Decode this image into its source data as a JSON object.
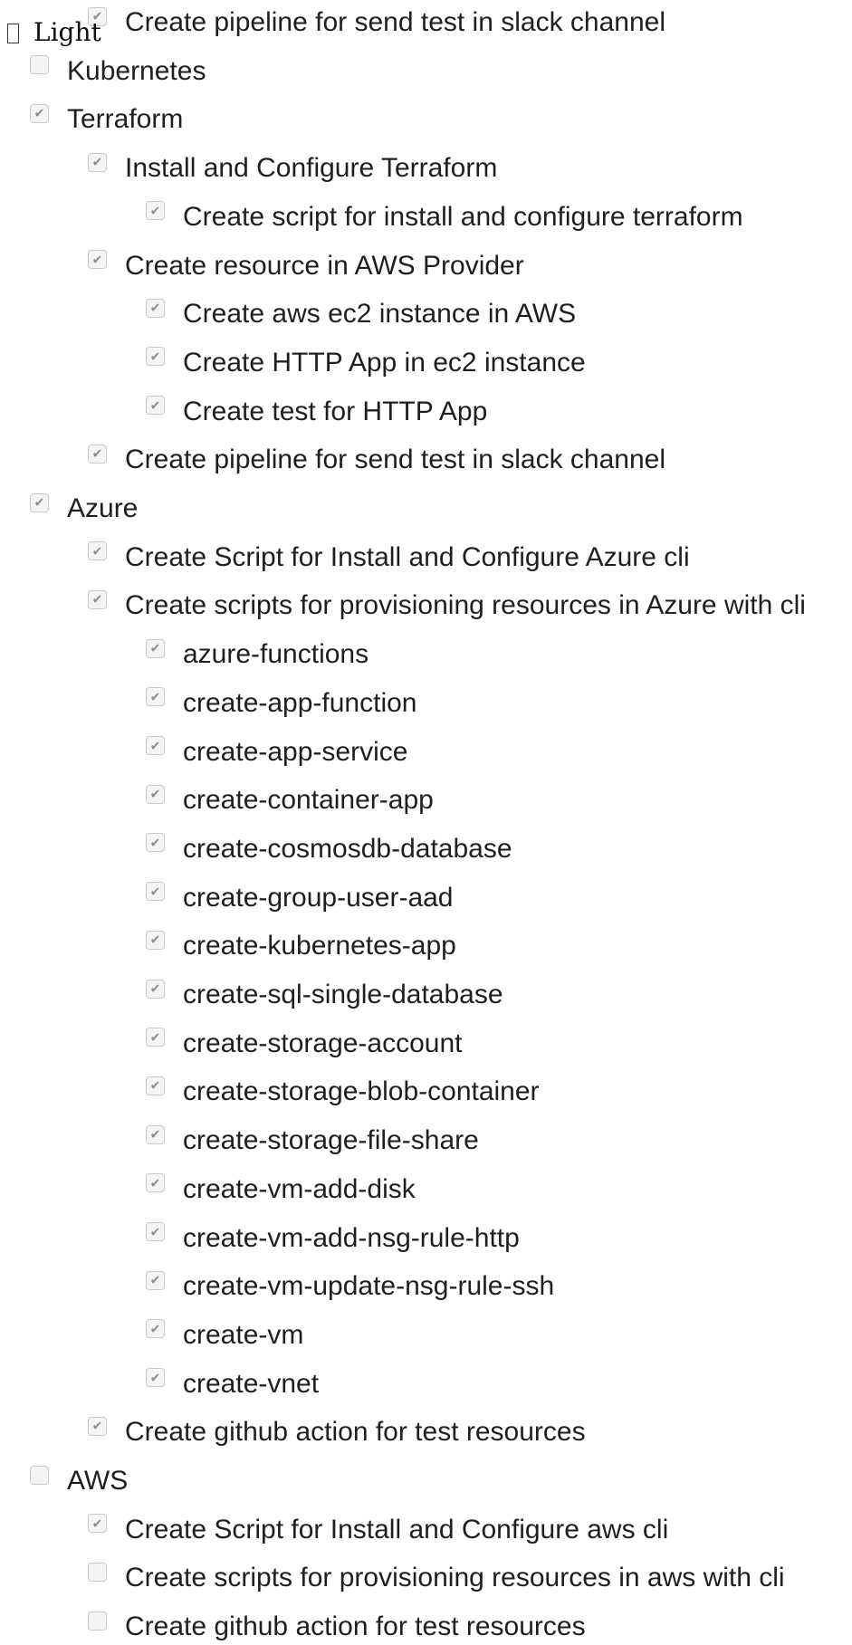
{
  "theme_toggle": {
    "label": "Light"
  },
  "tasks": [
    {
      "label": "Create pipeline for send test in slack channel",
      "checked": true,
      "level": 2
    },
    {
      "label": "Kubernetes",
      "checked": false,
      "level": 1
    },
    {
      "label": "Terraform",
      "checked": true,
      "level": 1
    },
    {
      "label": "Install and Configure Terraform",
      "checked": true,
      "level": 2
    },
    {
      "label": "Create script for install and configure terraform",
      "checked": true,
      "level": 3
    },
    {
      "label": "Create resource in AWS Provider",
      "checked": true,
      "level": 2
    },
    {
      "label": "Create aws ec2 instance in AWS",
      "checked": true,
      "level": 3
    },
    {
      "label": "Create HTTP App in ec2 instance",
      "checked": true,
      "level": 3
    },
    {
      "label": "Create test for HTTP App",
      "checked": true,
      "level": 3
    },
    {
      "label": "Create pipeline for send test in slack channel",
      "checked": true,
      "level": 2
    },
    {
      "label": "Azure",
      "checked": true,
      "level": 1
    },
    {
      "label": "Create Script for Install and Configure Azure cli",
      "checked": true,
      "level": 2
    },
    {
      "label": "Create scripts for provisioning resources in Azure with cli",
      "checked": true,
      "level": 2
    },
    {
      "label": "azure-functions",
      "checked": true,
      "level": 3
    },
    {
      "label": "create-app-function",
      "checked": true,
      "level": 3
    },
    {
      "label": "create-app-service",
      "checked": true,
      "level": 3
    },
    {
      "label": "create-container-app",
      "checked": true,
      "level": 3
    },
    {
      "label": "create-cosmosdb-database",
      "checked": true,
      "level": 3
    },
    {
      "label": "create-group-user-aad",
      "checked": true,
      "level": 3
    },
    {
      "label": "create-kubernetes-app",
      "checked": true,
      "level": 3
    },
    {
      "label": "create-sql-single-database",
      "checked": true,
      "level": 3
    },
    {
      "label": "create-storage-account",
      "checked": true,
      "level": 3
    },
    {
      "label": "create-storage-blob-container",
      "checked": true,
      "level": 3
    },
    {
      "label": "create-storage-file-share",
      "checked": true,
      "level": 3
    },
    {
      "label": "create-vm-add-disk",
      "checked": true,
      "level": 3
    },
    {
      "label": "create-vm-add-nsg-rule-http",
      "checked": true,
      "level": 3
    },
    {
      "label": "create-vm-update-nsg-rule-ssh",
      "checked": true,
      "level": 3
    },
    {
      "label": "create-vm",
      "checked": true,
      "level": 3
    },
    {
      "label": "create-vnet",
      "checked": true,
      "level": 3
    },
    {
      "label": "Create github action for test resources",
      "checked": true,
      "level": 2
    },
    {
      "label": "AWS",
      "checked": false,
      "level": 1
    },
    {
      "label": "Create Script for Install and Configure aws cli",
      "checked": true,
      "level": 2
    },
    {
      "label": "Create scripts for provisioning resources in aws with cli",
      "checked": false,
      "level": 2
    },
    {
      "label": "Create github action for test resources",
      "checked": false,
      "level": 2
    }
  ]
}
